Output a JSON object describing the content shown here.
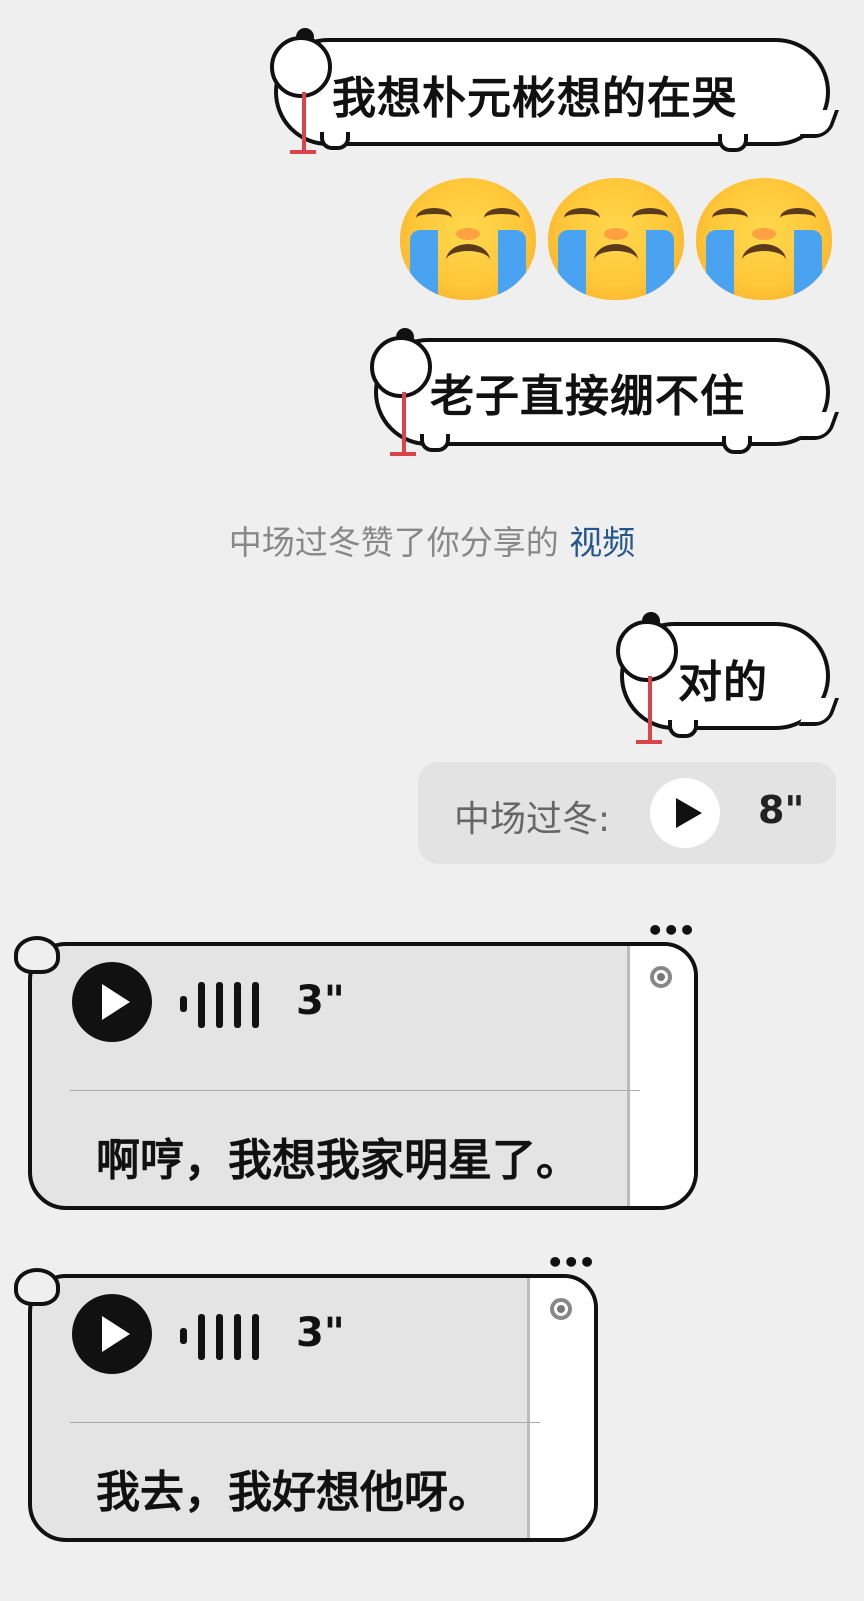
{
  "messages": {
    "sticker1": {
      "text": "我想朴元彬想的在哭"
    },
    "emoji_row": {
      "emojis": [
        "😭",
        "😭",
        "😭"
      ],
      "emoji_name": "loudly-crying-face"
    },
    "sticker2": {
      "text": "老子直接绷不住"
    },
    "notice": {
      "prefix": "中场过冬赞了你分享的",
      "link": "视频"
    },
    "sticker3": {
      "text": "对的"
    },
    "quote": {
      "name": "中场过冬:",
      "duration": "8\""
    },
    "voice1": {
      "duration": "3\"",
      "transcript": "啊哼，我想我家明星了。",
      "more": "•••"
    },
    "voice2": {
      "duration": "3\"",
      "transcript": "我去，我好想他呀。",
      "more": "•••"
    }
  },
  "colors": {
    "background": "#efefef",
    "link": "#25578d",
    "tear": "#d9434a"
  }
}
